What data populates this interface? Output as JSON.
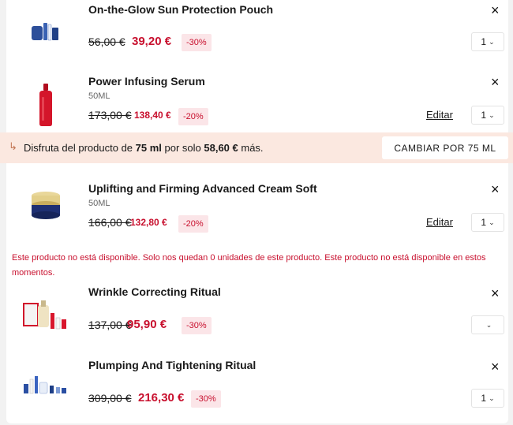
{
  "items": [
    {
      "name": "On-the-Glow Sun Protection Pouch",
      "size": "",
      "old_price": "56,00 €",
      "new_price": "39,20 €",
      "discount": "-30%",
      "qty": "1",
      "edit_label": "",
      "close_icon": "×"
    },
    {
      "name": "Power Infusing Serum",
      "size": "50ML",
      "old_price": "173,00 €",
      "new_price": "138,40 €",
      "discount": "-20%",
      "qty": "1",
      "edit_label": "Editar",
      "close_icon": "×"
    },
    {
      "name": "Uplifting and Firming Advanced Cream Soft",
      "size": "50ML",
      "old_price": "166,00 €",
      "new_price": "132,80 €",
      "discount": "-20%",
      "qty": "1",
      "edit_label": "Editar",
      "close_icon": "×"
    },
    {
      "name": "Wrinkle Correcting Ritual",
      "size": "",
      "old_price": "137,00 €",
      "new_price": "95,90 €",
      "discount": "-30%",
      "qty": "",
      "edit_label": "",
      "close_icon": "×"
    },
    {
      "name": "Plumping And Tightening Ritual",
      "size": "",
      "old_price": "309,00 €",
      "new_price": "216,30 €",
      "discount": "-30%",
      "qty": "1",
      "edit_label": "",
      "close_icon": "×"
    }
  ],
  "upsell": {
    "text_before": "Disfruta del producto de ",
    "size": "75 ml",
    "text_middle": " por solo ",
    "price": "58,60 €",
    "text_after": " más.",
    "button_label": "CAMBIAR POR 75 ML"
  },
  "warning": "Este producto no está disponible. Solo nos quedan 0 unidades de este producto. Este producto no está disponible en estos momentos.",
  "colors": {
    "accent_red": "#c8102e",
    "discount_bg": "#fbe5e8",
    "upsell_bg": "#fbe8e0"
  },
  "icons": {
    "close": "close-icon",
    "chevron": "chevron-down-icon",
    "upsell_arrow": "arrow-return-icon"
  }
}
